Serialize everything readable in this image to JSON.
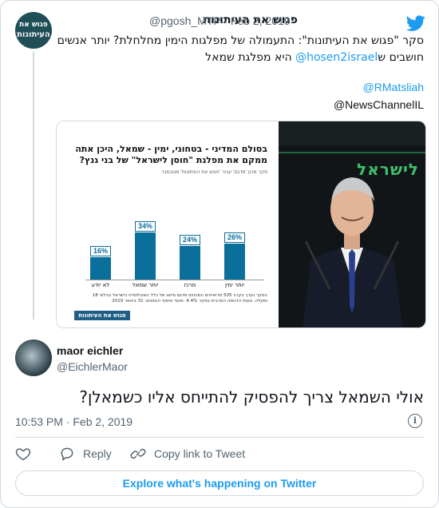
{
  "quoted": {
    "avatar_text_line1": "פגוש את",
    "avatar_text_line2": "העיתונות",
    "display_name": "פגוש את העיתונות",
    "handle": "@pgosh_MTP",
    "separator": "·",
    "date": "Feb 2, 2019",
    "text_line1": "סקר \"פגוש את העיתונות\": התעמולה של מפלגות הימין מחלחלת? יותר אנשים",
    "text_line2_a": "חושבים ש",
    "text_line2_link": "@hosen2israel",
    "text_line2_b": " היא מפלגת שמאל",
    "mention1": "@RMatsliah",
    "mention2": "@NewsChannelIL"
  },
  "media": {
    "title": "בסולם המדיני - בטחוני, ימין - שמאל, היכן אתה ממקם את מפלגת \"חוסן לישראל\" של בני גנץ?",
    "subtitle": "סקר מכון 'מדגם' עבור 'פגוש את העיתונות' מנובמבר",
    "footnote": "הסקר נערך בקרב 505 מרואיינים המהווים מדגם מייצג של כלל האוכלוסייה בישראל בגילאי 18 ומעלה. טעות הדגימה המרבית בסקר 4.4%. מועד איסוף הנתונים: 31 בינואר 2019",
    "logo_strip": "פגוש את העיתונות",
    "sign_text": "לישראל",
    "chart_color": "#0a6f9a"
  },
  "chart_data": {
    "type": "bar",
    "categories": [
      "לא יודע",
      "יותר שמאל",
      "מרכז",
      "יותר ימין"
    ],
    "values": [
      16,
      34,
      24,
      26
    ],
    "value_labels": [
      "16%",
      "34%",
      "24%",
      "26%"
    ],
    "ylim": [
      0,
      40
    ]
  },
  "reply": {
    "display_name": "maor eichler",
    "handle": "@EichlerMaor",
    "text": "אולי השמאל צריך להפסיק להתייחס אליו כשמאלן?",
    "time": "10:53 PM · Feb 2, 2019"
  },
  "actions": {
    "reply_label": "Reply",
    "copy_label": "Copy link to Tweet",
    "explore_label": "Explore what's happening on Twitter"
  },
  "colors": {
    "accent": "#1d9bf0",
    "secondary_text": "#536471",
    "border": "#cfd9de"
  },
  "icons": {
    "logo": "twitter-bird-icon",
    "info": "info-icon",
    "like": "heart-icon",
    "reply": "reply-icon",
    "copy": "link-icon"
  }
}
